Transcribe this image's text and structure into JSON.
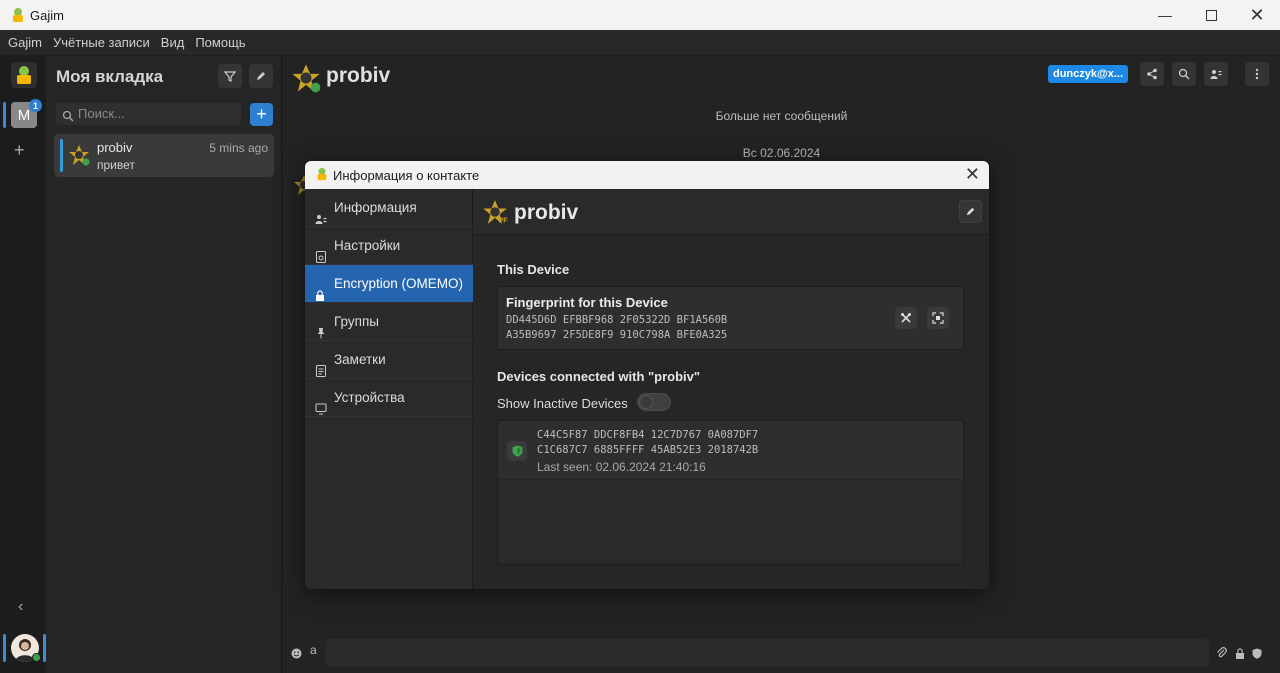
{
  "window": {
    "title": "Gajim"
  },
  "menu": [
    "Gajim",
    "Учётные записи",
    "Вид",
    "Помощь"
  ],
  "workspace": {
    "initial": "M",
    "badge": "1"
  },
  "sidebar": {
    "title": "Моя вкладка",
    "search_placeholder": "Поиск...",
    "chats": [
      {
        "name": "probiv",
        "time": "5 mins ago",
        "message": "привет"
      }
    ]
  },
  "chat": {
    "name": "probiv",
    "account_badge": "dunczyk@x...",
    "no_more_messages": "Больше нет сообщений",
    "date_separator": "Вс 02.06.2024"
  },
  "dialog": {
    "title": "Информация о контакте",
    "nav": [
      {
        "label": "Информация",
        "icon": "person-card-icon"
      },
      {
        "label": "Настройки",
        "icon": "settings-doc-icon"
      },
      {
        "label": "Encryption (OMEMO)",
        "icon": "lock-icon",
        "active": true
      },
      {
        "label": "Группы",
        "icon": "pin-icon"
      },
      {
        "label": "Заметки",
        "icon": "note-icon"
      },
      {
        "label": "Устройства",
        "icon": "monitor-icon"
      }
    ],
    "contact_name": "probiv",
    "this_device_title": "This Device",
    "fingerprint_label": "Fingerprint for this Device",
    "fingerprint_line1": "DD445D6D EFBBF968 2F05322D BF1A560B",
    "fingerprint_line2": "A35B9697 2F5DE8F9 910C798A BFE0A325",
    "devices_title": "Devices connected with \"probiv\"",
    "show_inactive_label": "Show Inactive Devices",
    "show_inactive": false,
    "devices": [
      {
        "line1": "C44C5F87 DDCF8FB4 12C7D767 0A087DF7",
        "line2": "C1C687C7 6885FFFF 45AB52E3 2018742B",
        "last_seen": "Last seen: 02.06.2024 21:40:16"
      }
    ]
  },
  "colors": {
    "accent": "#2f7fd0",
    "active_nav": "#2565b0",
    "badge": "#1e88e5",
    "trusted": "#3fa34d"
  }
}
